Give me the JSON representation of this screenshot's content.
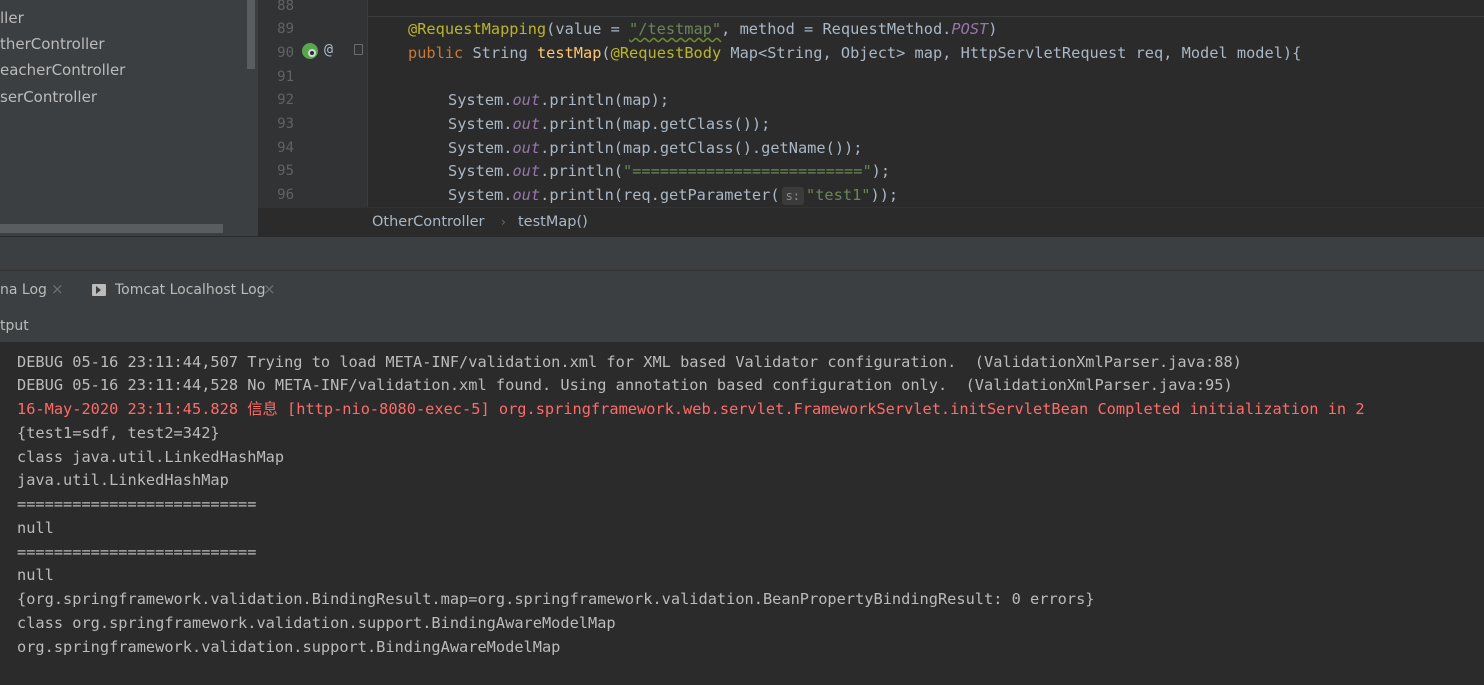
{
  "project_tree": {
    "items": [
      {
        "label": "ller"
      },
      {
        "label": "therController"
      },
      {
        "label": "eacherController"
      },
      {
        "label": "serController"
      }
    ]
  },
  "editor": {
    "line_numbers": [
      "88",
      "89",
      "90",
      "91",
      "92",
      "93",
      "94",
      "95",
      "96"
    ],
    "line89": {
      "annotation": "@RequestMapping",
      "p1": "(value = ",
      "str": "\"/testmap\"",
      "p2": ", method = RequestMethod.",
      "post": "POST",
      "p3": ")"
    },
    "line90": {
      "public": "public",
      "p1": " String ",
      "method": "testMap",
      "p2": "(",
      "annotation": "@RequestBody",
      "p3": " Map<String, Object> map, HttpServletRequest req, Model model){"
    },
    "line92": {
      "a": "System.",
      "out": "out",
      "b": ".println(map);"
    },
    "line93": {
      "a": "System.",
      "out": "out",
      "b": ".println(map.getClass());"
    },
    "line94": {
      "a": "System.",
      "out": "out",
      "b": ".println(map.getClass().getName());"
    },
    "line95": {
      "a": "System.",
      "out": "out",
      "b": ".println(",
      "str": "\"=========================\"",
      "c": ");"
    },
    "line96": {
      "a": "System.",
      "out": "out",
      "b": ".println(req.getParameter(",
      "hint": "s:",
      "str": "\"test1\"",
      "c": "));"
    },
    "gutter_at": "@"
  },
  "breadcrumb": {
    "class": "OtherController",
    "method": "testMap()",
    "separator": "›"
  },
  "tool_tabs": {
    "tab1": "na Log",
    "tab2": "Tomcat Localhost Log",
    "close": "×"
  },
  "output_label": "tput",
  "console": {
    "lines": [
      "DEBUG 05-16 23:11:44,507 Trying to load META-INF/validation.xml for XML based Validator configuration.  (ValidationXmlParser.java:88)",
      "DEBUG 05-16 23:11:44,528 No META-INF/validation.xml found. Using annotation based configuration only.  (ValidationXmlParser.java:95)",
      "16-May-2020 23:11:45.828 信息 [http-nio-8080-exec-5] org.springframework.web.servlet.FrameworkServlet.initServletBean Completed initialization in 2",
      "{test1=sdf, test2=342}",
      "class java.util.LinkedHashMap",
      "java.util.LinkedHashMap",
      "==========================",
      "null",
      "==========================",
      "null",
      "{org.springframework.validation.BindingResult.map=org.springframework.validation.BeanPropertyBindingResult: 0 errors}",
      "class org.springframework.validation.support.BindingAwareModelMap",
      "org.springframework.validation.support.BindingAwareModelMap"
    ]
  },
  "colors": {
    "error": "#ff6b68",
    "keyword": "#cc7832",
    "string": "#6a8759",
    "annotation": "#bbb529",
    "field": "#9876aa"
  }
}
